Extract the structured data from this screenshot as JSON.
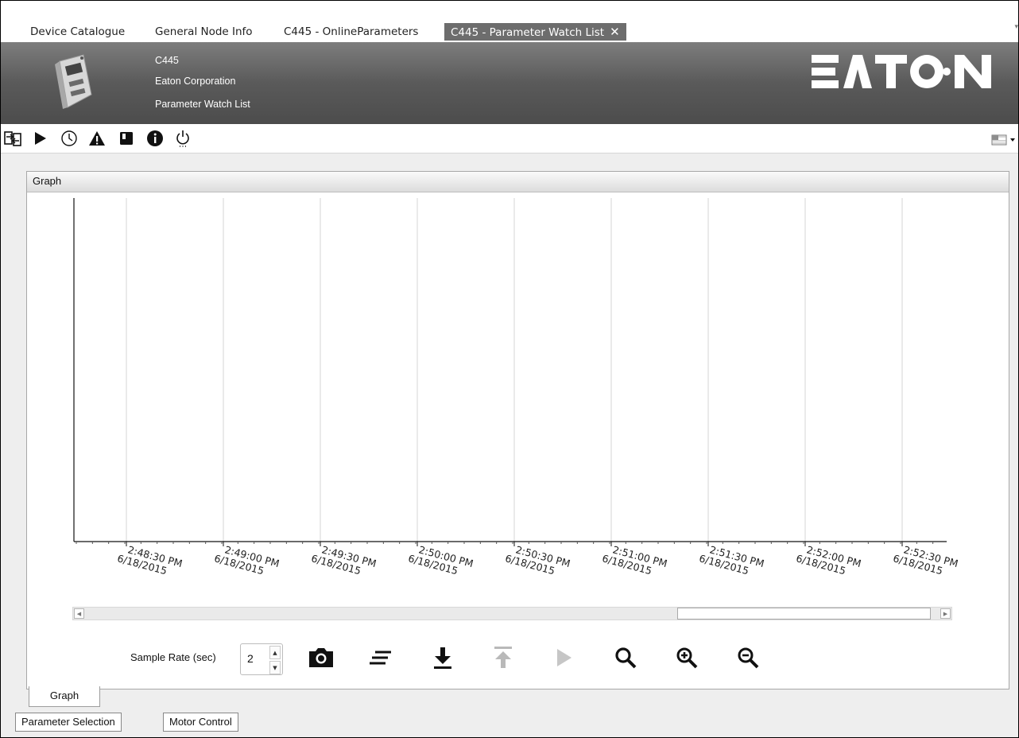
{
  "tabs": [
    {
      "label": "Device Catalogue",
      "active": false
    },
    {
      "label": "General Node Info",
      "active": false
    },
    {
      "label": "C445 - OnlineParameters",
      "active": false
    },
    {
      "label": "C445 - Parameter Watch List",
      "active": true
    }
  ],
  "header": {
    "device": "C445",
    "company": "Eaton Corporation",
    "view": "Parameter Watch List",
    "logo_text": "EATON"
  },
  "toolbar_icons": [
    "connect-icon",
    "play-icon",
    "clock-icon",
    "warning-icon",
    "book-icon",
    "info-icon",
    "power-icon",
    "flag-dropdown-icon"
  ],
  "panel": {
    "title": "Graph"
  },
  "chart_data": {
    "type": "line",
    "title": "",
    "xlabel": "",
    "ylabel": "",
    "series": [],
    "x_ticks": [
      {
        "time": "2:48:30 PM",
        "date": "6/18/2015"
      },
      {
        "time": "2:49:00 PM",
        "date": "6/18/2015"
      },
      {
        "time": "2:49:30 PM",
        "date": "6/18/2015"
      },
      {
        "time": "2:50:00 PM",
        "date": "6/18/2015"
      },
      {
        "time": "2:50:30 PM",
        "date": "6/18/2015"
      },
      {
        "time": "2:51:00 PM",
        "date": "6/18/2015"
      },
      {
        "time": "2:51:30 PM",
        "date": "6/18/2015"
      },
      {
        "time": "2:52:00 PM",
        "date": "6/18/2015"
      },
      {
        "time": "2:52:30 PM",
        "date": "6/18/2015"
      }
    ],
    "grid": "vertical"
  },
  "controls": {
    "sample_rate_label": "Sample Rate (sec)",
    "sample_rate_value": "2",
    "buttons": [
      "camera-icon",
      "lines-icon",
      "download-icon",
      "upload-icon",
      "play-icon",
      "zoom-icon",
      "zoom-in-icon",
      "zoom-out-icon"
    ]
  },
  "inner_tab": "Graph",
  "bottom_tabs": [
    "Parameter Selection",
    "Motor Control"
  ]
}
